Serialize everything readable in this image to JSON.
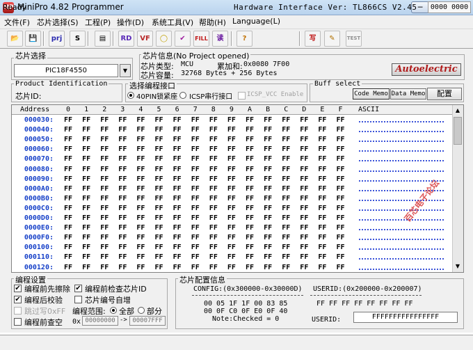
{
  "window": {
    "title": "MiniPro 4.82 Programmer",
    "app_icon": "MP",
    "min": "─",
    "max": "☐",
    "close": "✕"
  },
  "menu": [
    "文件(F)",
    "芯片选择(S)",
    "工程(P)",
    "操作(D)",
    "系统工具(V)",
    "帮助(H)",
    "Language(L)"
  ],
  "toolbar": {
    "icons": [
      "open-folder-icon",
      "save-disk-icon",
      "open-project-icon",
      "save-project-icon",
      "save-file-icon",
      "read-icon",
      "verify-icon",
      "blank-check-icon",
      "erase-icon",
      "fill-icon",
      "program-icon",
      "help-icon",
      "write-icon",
      "edit-icon",
      "test-icon"
    ],
    "glyphs": [
      "📂",
      "💾",
      "prj",
      "S",
      "▤",
      "RD",
      "VF",
      "◯",
      "✔",
      "FILL",
      "读",
      "?",
      "写",
      "✎",
      "TEST"
    ]
  },
  "chip_select": {
    "title": "芯片选择",
    "value": "PIC18F4550"
  },
  "chip_info": {
    "title": "芯片信息(No Project opened)",
    "type_label": "芯片类型:",
    "type_value": "MCU",
    "checksum_label": "累加和:",
    "checksum_value": "0x0080 7F00",
    "capacity_label": "芯片容量:",
    "capacity_value": "32768 Bytes + 256 Bytes",
    "logo": "Autoelectric"
  },
  "product_id": {
    "title": "Product Identification",
    "label": "芯片ID:"
  },
  "prog_port": {
    "title": "选择编程接口",
    "opt1": "40PIN锁紧座",
    "opt2": "ICSP串行接口",
    "opt3": "ICSP_VCC Enable",
    "selected": "40PIN锁紧座"
  },
  "buff_select": {
    "title": "Buff select",
    "code_memo": "Code Memo",
    "data_memo": "Data Memo",
    "config": "配置"
  },
  "hex": {
    "address_header": "Address",
    "columns": [
      "0",
      "1",
      "2",
      "3",
      "4",
      "5",
      "6",
      "7",
      "8",
      "9",
      "A",
      "B",
      "C",
      "D",
      "E",
      "F"
    ],
    "ascii_header": "ASCII",
    "addresses": [
      "000030:",
      "000040:",
      "000050:",
      "000060:",
      "000070:",
      "000080:",
      "000090:",
      "0000A0:",
      "0000B0:",
      "0000C0:",
      "0000D0:",
      "0000E0:",
      "0000F0:",
      "000100:",
      "000110:",
      "000120:"
    ],
    "byte_value": "FF",
    "accent": "#1640c8"
  },
  "watermark": "百芯电子论坛",
  "prog_settings": {
    "title": "编程设置",
    "pre_erase": "编程前先擦除",
    "post_verify": "编程后校验",
    "skip_ff": "跳过写0xFF",
    "pre_blank": "编程前查空",
    "check_id": "编程前检查芯片ID",
    "serial_inc": "芯片编号自增",
    "range_label": "编程范围:",
    "range_all": "全部",
    "range_part": "部分",
    "range_prefix": "0x",
    "range_from": "00000000",
    "range_arrow": "->",
    "range_to": "00007FFF"
  },
  "config_info": {
    "title": "芯片配置信息",
    "config_label": "CONFIG:(0x300000-0x30000D)",
    "config_line1": "00 05 1F 1F 00 83 85",
    "config_line2": "00 0F C0 0F E0 0F 40",
    "note": "Note:Checked = 0",
    "userid_label": "USERID:(0x200000-0x200007)",
    "userid_bytes": "FF FF FF FF FF FF FF FF",
    "userid_field_label": "USERID:",
    "userid_field_value": "FFFFFFFFFFFFFFFF"
  },
  "status": {
    "ready": "Ready",
    "hardware": "Hardware Interface Ver: TL866CS V2.45",
    "counter": "0000 0000"
  }
}
